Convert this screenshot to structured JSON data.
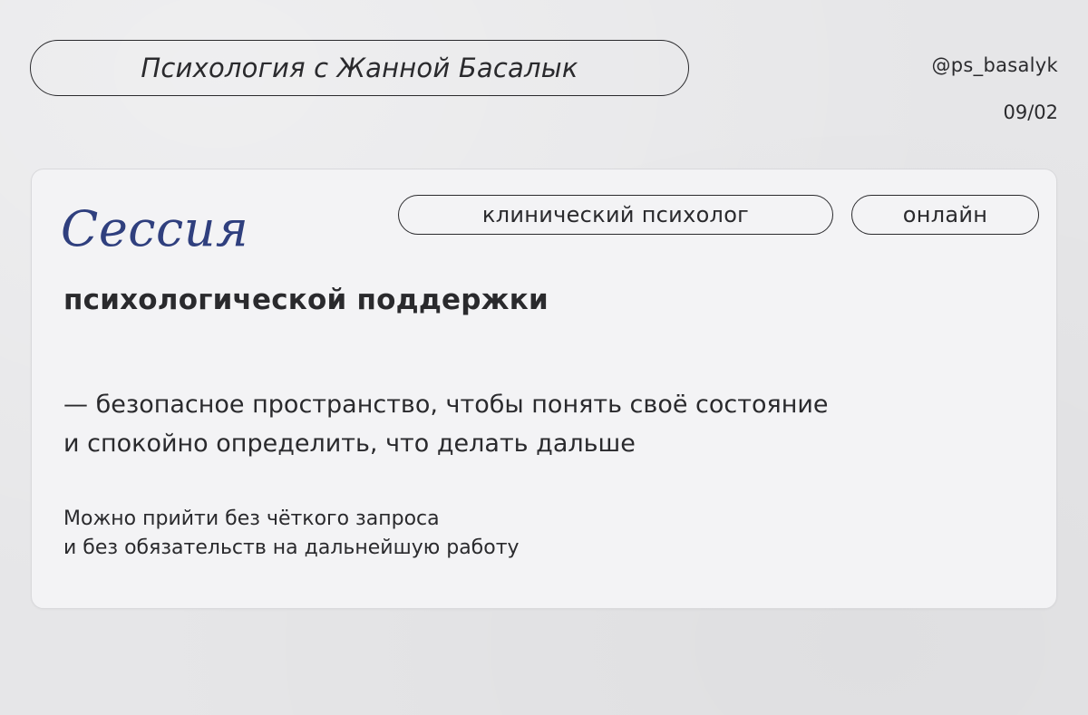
{
  "header": {
    "title": "Психология с Жанной Басалык",
    "handle": "@ps_basalyk",
    "page_number": "09/02"
  },
  "card": {
    "tags": {
      "role": "клинический психолог",
      "mode": "онлайн"
    },
    "script_title": "Сессия",
    "subtitle": "психологической поддержки",
    "lead": {
      "line1": "— безопасное пространство, чтобы понять своё состояние",
      "line2": "и спокойно определить, что делать дальше"
    },
    "note": {
      "line1": "Можно прийти без чёткого запроса",
      "line2": "и без обязательств на дальнейшую работу"
    }
  },
  "colors": {
    "background": "#e6e6e8",
    "card": "#f3f3f5",
    "text": "#2a2a2d",
    "accent": "#2f3f7e"
  }
}
